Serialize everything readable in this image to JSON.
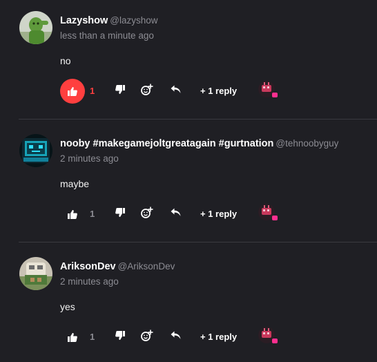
{
  "comments": [
    {
      "author": "Lazyshow",
      "handle": "@lazyshow",
      "time": "less than a minute ago",
      "body": "no",
      "likes": "1",
      "replies": "+ 1 reply",
      "liked": true
    },
    {
      "author": "nooby #makegamejoltgreatagain #gurtnation",
      "handle": "@tehnoobyguy",
      "time": "2 minutes ago",
      "body": "maybe",
      "likes": "1",
      "replies": "+ 1 reply",
      "liked": false
    },
    {
      "author": "AriksonDev",
      "handle": "@AriksonDev",
      "time": "2 minutes ago",
      "body": "yes",
      "likes": "1",
      "replies": "+ 1 reply",
      "liked": false
    }
  ],
  "icons": {
    "like": "thumbs-up-icon",
    "dislike": "thumbs-down-icon",
    "react": "add-reaction-icon",
    "reply": "reply-arrow-icon"
  },
  "colors": {
    "background": "#1f1f24",
    "like_active": "#ff3f3f",
    "muted": "#8c8c93",
    "reaction_badge": "#ff2f8f"
  }
}
